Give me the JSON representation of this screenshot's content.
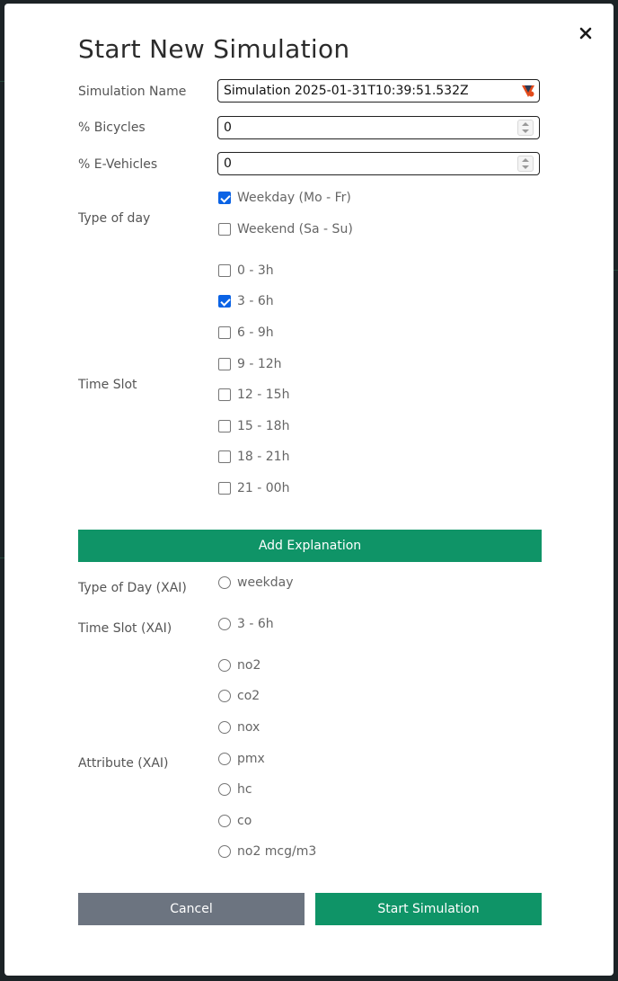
{
  "dialog": {
    "title": "Start New Simulation",
    "close_label": "×"
  },
  "fields": {
    "simulation_name": {
      "label": "Simulation Name",
      "value": "Simulation 2025-01-31T10:39:51.532Z"
    },
    "bicycles": {
      "label": "% Bicycles",
      "value": "0"
    },
    "e_vehicles": {
      "label": "% E-Vehicles",
      "value": "0"
    }
  },
  "type_of_day": {
    "label": "Type of day",
    "options": [
      {
        "label": "Weekday (Mo - Fr)",
        "checked": true
      },
      {
        "label": "Weekend (Sa - Su)",
        "checked": false
      }
    ]
  },
  "time_slot": {
    "label": "Time Slot",
    "options": [
      {
        "label": "0 - 3h",
        "checked": false
      },
      {
        "label": "3 - 6h",
        "checked": true
      },
      {
        "label": "6 - 9h",
        "checked": false
      },
      {
        "label": "9 - 12h",
        "checked": false
      },
      {
        "label": "12 - 15h",
        "checked": false
      },
      {
        "label": "15 - 18h",
        "checked": false
      },
      {
        "label": "18 - 21h",
        "checked": false
      },
      {
        "label": "21 - 00h",
        "checked": false
      }
    ]
  },
  "explanation": {
    "button_label": "Add Explanation",
    "type_of_day_xai": {
      "label": "Type of Day (XAI)",
      "options": [
        "weekday"
      ]
    },
    "time_slot_xai": {
      "label": "Time Slot (XAI)",
      "options": [
        "3 - 6h"
      ]
    },
    "attribute_xai": {
      "label": "Attribute (XAI)",
      "options": [
        "no2",
        "co2",
        "nox",
        "pmx",
        "hc",
        "co",
        "no2 mcg/m3"
      ]
    }
  },
  "actions": {
    "cancel_label": "Cancel",
    "start_label": "Start Simulation"
  },
  "colors": {
    "primary_green": "#0f9467",
    "cancel_gray": "#6c7480",
    "checkbox_blue": "#0b63e5"
  }
}
